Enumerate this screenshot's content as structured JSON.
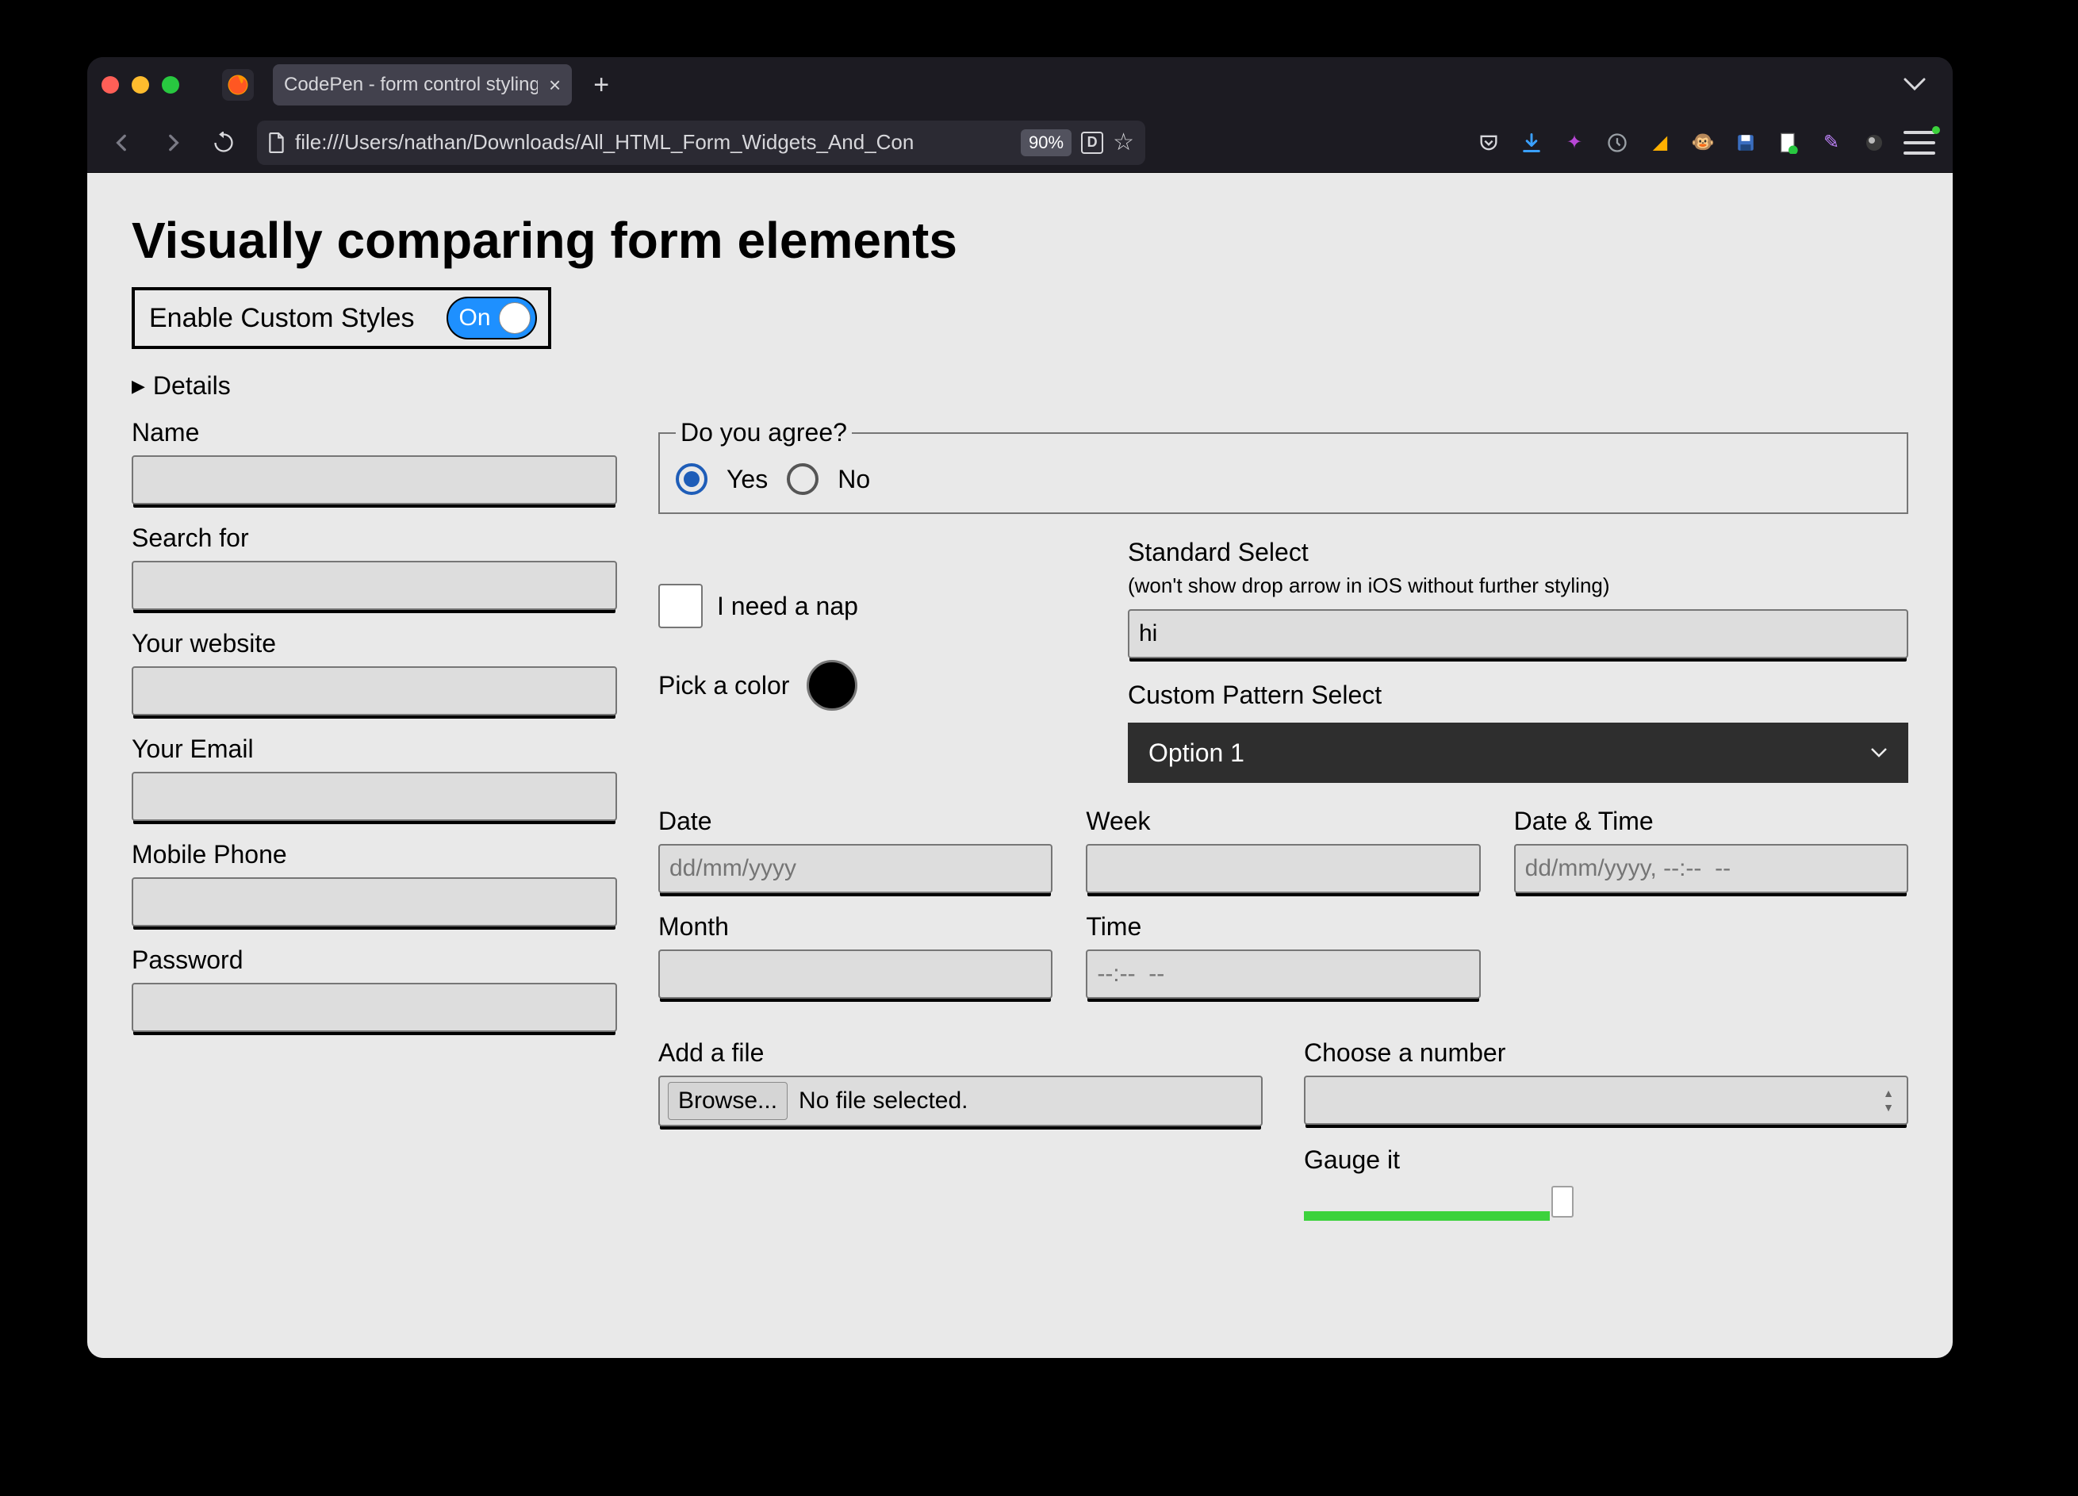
{
  "browser": {
    "tab_title": "CodePen - form control styling comp",
    "url": "file:///Users/nathan/Downloads/All_HTML_Form_Widgets_And_Con",
    "zoom": "90%",
    "reader_badge": "D"
  },
  "page": {
    "heading": "Visually comparing form elements",
    "toggle_label": "Enable Custom Styles",
    "toggle_state": "On",
    "details_label": "Details"
  },
  "left": {
    "name": "Name",
    "search": "Search for",
    "website": "Your website",
    "email": "Your Email",
    "phone": "Mobile Phone",
    "password": "Password"
  },
  "agree": {
    "legend": "Do you agree?",
    "yes": "Yes",
    "no": "No"
  },
  "checkbox_label": "I need a nap",
  "color_label": "Pick a color",
  "selects": {
    "standard_label": "Standard Select",
    "standard_note": "(won't show drop arrow in iOS without further styling)",
    "standard_value": "hi",
    "custom_label": "Custom Pattern Select",
    "custom_value": "Option 1"
  },
  "dates": {
    "date_label": "Date",
    "date_placeholder": "dd/mm/yyyy",
    "week_label": "Week",
    "datetime_label": "Date & Time",
    "datetime_placeholder": "dd/mm/yyyy, --:--  --",
    "month_label": "Month",
    "time_label": "Time",
    "time_placeholder": "--:--  --"
  },
  "file": {
    "label": "Add a file",
    "button": "Browse...",
    "status": "No file selected."
  },
  "number": {
    "label": "Choose a number"
  },
  "gauge": {
    "label": "Gauge it"
  }
}
